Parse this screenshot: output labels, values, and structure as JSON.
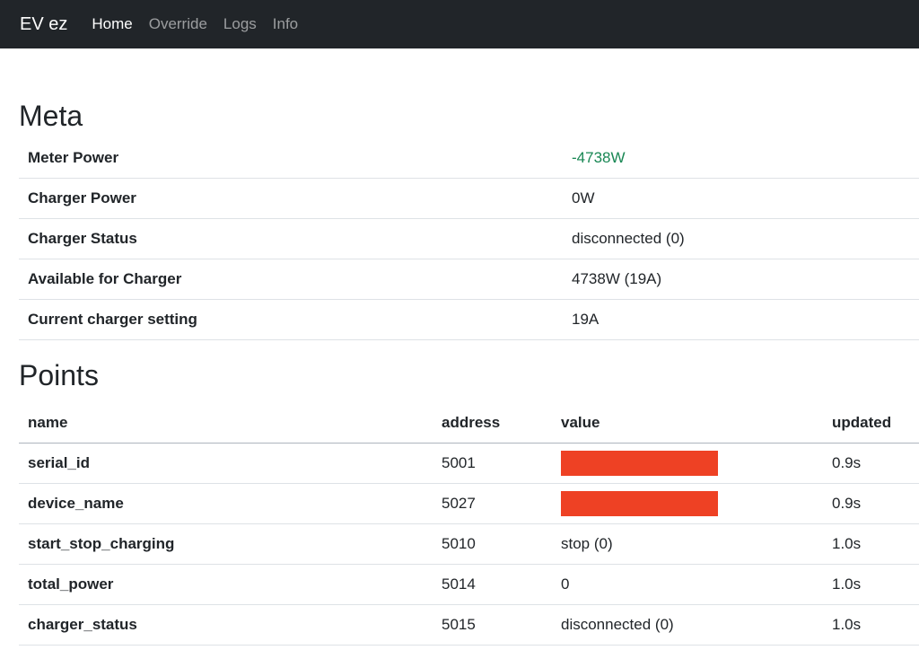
{
  "nav": {
    "brand": "EV ez",
    "links": [
      "Home",
      "Override",
      "Logs",
      "Info"
    ]
  },
  "meta": {
    "title": "Meta",
    "rows": [
      {
        "label": "Meter Power",
        "value": "-4738W"
      },
      {
        "label": "Charger Power",
        "value": "0W"
      },
      {
        "label": "Charger Status",
        "value": "disconnected (0)"
      },
      {
        "label": "Available for Charger",
        "value": "4738W (19A)"
      },
      {
        "label": "Current charger setting",
        "value": "19A"
      }
    ]
  },
  "points": {
    "title": "Points",
    "headers": [
      "name",
      "address",
      "value",
      "updated"
    ],
    "rows": [
      {
        "name": "serial_id",
        "address": "5001",
        "value": "",
        "updated": "0.9s"
      },
      {
        "name": "device_name",
        "address": "5027",
        "value": "",
        "updated": "0.9s"
      },
      {
        "name": "start_stop_charging",
        "address": "5010",
        "value": "stop (0)",
        "updated": "1.0s"
      },
      {
        "name": "total_power",
        "address": "5014",
        "value": "0",
        "updated": "1.0s"
      },
      {
        "name": "charger_status",
        "address": "5015",
        "value": "disconnected (0)",
        "updated": "1.0s"
      }
    ]
  },
  "colors": {
    "navbar_bg": "#212529",
    "positive_green": "#198754",
    "redaction_red": "#ee4124"
  }
}
